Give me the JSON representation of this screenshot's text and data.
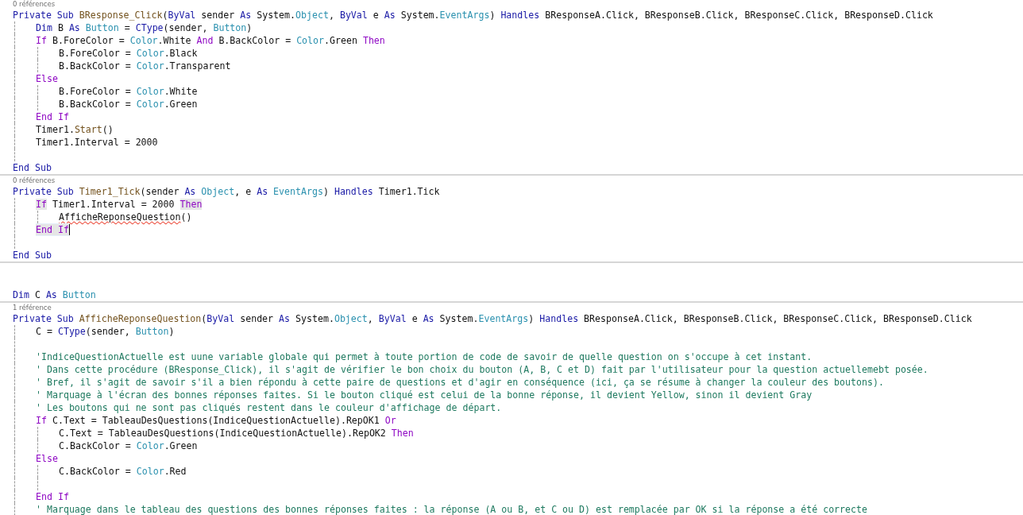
{
  "lines": [
    {
      "kind": "lens",
      "text": "0 références"
    },
    {
      "kind": "code",
      "tokens": [
        {
          "kind": "keyword",
          "text": "Private Sub "
        },
        {
          "kind": "method",
          "text": "BResponse_Click"
        },
        {
          "kind": "plain",
          "text": "("
        },
        {
          "kind": "keyword",
          "text": "ByVal "
        },
        {
          "kind": "plain",
          "text": "sender "
        },
        {
          "kind": "keyword",
          "text": "As "
        },
        {
          "kind": "plain",
          "text": "System."
        },
        {
          "kind": "type",
          "text": "Object"
        },
        {
          "kind": "plain",
          "text": ", "
        },
        {
          "kind": "keyword",
          "text": "ByVal "
        },
        {
          "kind": "plain",
          "text": "e "
        },
        {
          "kind": "keyword",
          "text": "As "
        },
        {
          "kind": "plain",
          "text": "System."
        },
        {
          "kind": "type",
          "text": "EventArgs"
        },
        {
          "kind": "plain",
          "text": ") "
        },
        {
          "kind": "keyword",
          "text": "Handles "
        },
        {
          "kind": "plain",
          "text": "BResponseA.Click, BResponseB.Click, BResponseC.Click, BResponseD.Click"
        }
      ],
      "children": [
        {
          "kind": "code",
          "tokens": [
            {
              "kind": "keyword",
              "text": "Dim "
            },
            {
              "kind": "plain",
              "text": "B "
            },
            {
              "kind": "keyword",
              "text": "As "
            },
            {
              "kind": "type",
              "text": "Button"
            },
            {
              "kind": "plain",
              "text": " = "
            },
            {
              "kind": "keyword",
              "text": "CType"
            },
            {
              "kind": "plain",
              "text": "(sender, "
            },
            {
              "kind": "type",
              "text": "Button"
            },
            {
              "kind": "plain",
              "text": ")"
            }
          ]
        },
        {
          "kind": "code",
          "tokens": [
            {
              "kind": "control",
              "text": "If "
            },
            {
              "kind": "plain",
              "text": "B.ForeColor = "
            },
            {
              "kind": "type",
              "text": "Color"
            },
            {
              "kind": "plain",
              "text": ".White "
            },
            {
              "kind": "control",
              "text": "And "
            },
            {
              "kind": "plain",
              "text": "B.BackColor = "
            },
            {
              "kind": "type",
              "text": "Color"
            },
            {
              "kind": "plain",
              "text": ".Green "
            },
            {
              "kind": "control",
              "text": "Then"
            }
          ],
          "children": [
            {
              "kind": "code",
              "tokens": [
                {
                  "kind": "plain",
                  "text": "B.ForeColor = "
                },
                {
                  "kind": "type",
                  "text": "Color"
                },
                {
                  "kind": "plain",
                  "text": ".Black"
                }
              ]
            },
            {
              "kind": "code",
              "tokens": [
                {
                  "kind": "plain",
                  "text": "B.BackColor = "
                },
                {
                  "kind": "type",
                  "text": "Color"
                },
                {
                  "kind": "plain",
                  "text": ".Transparent"
                }
              ]
            }
          ]
        },
        {
          "kind": "code",
          "tokens": [
            {
              "kind": "control",
              "text": "Else"
            }
          ],
          "children": [
            {
              "kind": "code",
              "tokens": [
                {
                  "kind": "plain",
                  "text": "B.ForeColor = "
                },
                {
                  "kind": "type",
                  "text": "Color"
                },
                {
                  "kind": "plain",
                  "text": ".White"
                }
              ]
            },
            {
              "kind": "code",
              "tokens": [
                {
                  "kind": "plain",
                  "text": "B.BackColor = "
                },
                {
                  "kind": "type",
                  "text": "Color"
                },
                {
                  "kind": "plain",
                  "text": ".Green"
                }
              ]
            }
          ]
        },
        {
          "kind": "code",
          "tokens": [
            {
              "kind": "control",
              "text": "End If"
            }
          ]
        },
        {
          "kind": "code",
          "tokens": [
            {
              "kind": "plain",
              "text": "Timer1."
            },
            {
              "kind": "method",
              "text": "Start"
            },
            {
              "kind": "plain",
              "text": "()"
            }
          ]
        },
        {
          "kind": "code",
          "tokens": [
            {
              "kind": "plain",
              "text": "Timer1.Interval = 2000"
            }
          ]
        },
        {
          "kind": "blank"
        }
      ]
    },
    {
      "kind": "code",
      "tokens": [
        {
          "kind": "keyword",
          "text": "End Sub"
        }
      ]
    },
    {
      "kind": "lens",
      "divider": true,
      "text": "0 références"
    },
    {
      "kind": "code",
      "tokens": [
        {
          "kind": "keyword",
          "text": "Private Sub "
        },
        {
          "kind": "method",
          "text": "Timer1_Tick"
        },
        {
          "kind": "plain",
          "text": "(sender "
        },
        {
          "kind": "keyword",
          "text": "As "
        },
        {
          "kind": "type",
          "text": "Object"
        },
        {
          "kind": "plain",
          "text": ", e "
        },
        {
          "kind": "keyword",
          "text": "As "
        },
        {
          "kind": "type",
          "text": "EventArgs"
        },
        {
          "kind": "plain",
          "text": ") "
        },
        {
          "kind": "keyword",
          "text": "Handles "
        },
        {
          "kind": "plain",
          "text": "Timer1.Tick"
        }
      ],
      "children": [
        {
          "kind": "code",
          "tokens": [
            {
              "kind": "control",
              "text": "If",
              "highlight": true
            },
            {
              "kind": "plain",
              "text": " Timer1.Interval = 2000 "
            },
            {
              "kind": "control",
              "text": "Then",
              "highlight": true
            }
          ],
          "children": [
            {
              "kind": "code",
              "tokens": [
                {
                  "kind": "plain",
                  "text": "AfficheReponseQuestion",
                  "squiggle": true
                },
                {
                  "kind": "plain",
                  "text": "()"
                }
              ]
            }
          ]
        },
        {
          "kind": "code",
          "current": true,
          "cursor": true,
          "tokens": [
            {
              "kind": "control",
              "text": "End If",
              "highlight": true
            }
          ]
        },
        {
          "kind": "blank"
        }
      ]
    },
    {
      "kind": "code",
      "tokens": [
        {
          "kind": "keyword",
          "text": "End Sub"
        }
      ]
    },
    {
      "kind": "blank",
      "divider": true
    },
    {
      "kind": "blank"
    },
    {
      "kind": "code",
      "tokens": [
        {
          "kind": "keyword",
          "text": "Dim "
        },
        {
          "kind": "plain",
          "text": "C "
        },
        {
          "kind": "keyword",
          "text": "As "
        },
        {
          "kind": "type",
          "text": "Button"
        }
      ]
    },
    {
      "kind": "lens",
      "divider": true,
      "text": "1 référence"
    },
    {
      "kind": "code",
      "tokens": [
        {
          "kind": "keyword",
          "text": "Private Sub "
        },
        {
          "kind": "method",
          "text": "AfficheReponseQuestion"
        },
        {
          "kind": "plain",
          "text": "("
        },
        {
          "kind": "keyword",
          "text": "ByVal "
        },
        {
          "kind": "plain",
          "text": "sender "
        },
        {
          "kind": "keyword",
          "text": "As "
        },
        {
          "kind": "plain",
          "text": "System."
        },
        {
          "kind": "type",
          "text": "Object"
        },
        {
          "kind": "plain",
          "text": ", "
        },
        {
          "kind": "keyword",
          "text": "ByVal "
        },
        {
          "kind": "plain",
          "text": "e "
        },
        {
          "kind": "keyword",
          "text": "As "
        },
        {
          "kind": "plain",
          "text": "System."
        },
        {
          "kind": "type",
          "text": "EventArgs"
        },
        {
          "kind": "plain",
          "text": ") "
        },
        {
          "kind": "keyword",
          "text": "Handles "
        },
        {
          "kind": "plain",
          "text": "BResponseA.Click, BResponseB.Click, BResponseC.Click, BResponseD.Click"
        }
      ],
      "children": [
        {
          "kind": "code",
          "tokens": [
            {
              "kind": "plain",
              "text": "C = "
            },
            {
              "kind": "keyword",
              "text": "CType"
            },
            {
              "kind": "plain",
              "text": "(sender, "
            },
            {
              "kind": "type",
              "text": "Button"
            },
            {
              "kind": "plain",
              "text": ")"
            }
          ]
        },
        {
          "kind": "blank"
        },
        {
          "kind": "code",
          "tokens": [
            {
              "kind": "comment",
              "text": "'IndiceQuestionActuelle est uune variable globale qui permet à toute portion de code de savoir de quelle question on s'occupe à cet instant."
            }
          ]
        },
        {
          "kind": "code",
          "tokens": [
            {
              "kind": "comment",
              "text": "' Dans cette procédure (BResponse_Click), il s'agit de vérifier le bon choix du bouton (A, B, C et D) fait par l'utilisateur pour la question actuellemebt posée."
            }
          ]
        },
        {
          "kind": "code",
          "tokens": [
            {
              "kind": "comment",
              "text": "' Bref, il s'agit de savoir s'il a bien répondu à cette paire de questions et d'agir en conséquence (ici, ça se résume à changer la couleur des boutons)."
            }
          ]
        },
        {
          "kind": "code",
          "tokens": [
            {
              "kind": "comment",
              "text": "' Marquage à l'écran des bonnes réponses faites. Si le bouton cliqué est celui de la bonne réponse, il devient Yellow, sinon il devient Gray"
            }
          ]
        },
        {
          "kind": "code",
          "tokens": [
            {
              "kind": "comment",
              "text": "' Les boutons qui ne sont pas cliqués restent dans le couleur d'affichage de départ."
            }
          ]
        },
        {
          "kind": "code",
          "tokens": [
            {
              "kind": "control",
              "text": "If "
            },
            {
              "kind": "plain",
              "text": "C.Text = TableauDesQuestions(IndiceQuestionActuelle).RepOK1 "
            },
            {
              "kind": "control",
              "text": "Or"
            }
          ],
          "children": [
            {
              "kind": "code",
              "tokens": [
                {
                  "kind": "plain",
                  "text": "C.Text = TableauDesQuestions(IndiceQuestionActuelle).RepOK2 "
                },
                {
                  "kind": "control",
                  "text": "Then"
                }
              ]
            },
            {
              "kind": "code",
              "tokens": [
                {
                  "kind": "plain",
                  "text": "C.BackColor = "
                },
                {
                  "kind": "type",
                  "text": "Color"
                },
                {
                  "kind": "plain",
                  "text": ".Green"
                }
              ]
            }
          ]
        },
        {
          "kind": "code",
          "tokens": [
            {
              "kind": "control",
              "text": "Else"
            }
          ],
          "children": [
            {
              "kind": "code",
              "tokens": [
                {
                  "kind": "plain",
                  "text": "C.BackColor = "
                },
                {
                  "kind": "type",
                  "text": "Color"
                },
                {
                  "kind": "plain",
                  "text": ".Red"
                }
              ]
            },
            {
              "kind": "blank"
            }
          ]
        },
        {
          "kind": "code",
          "tokens": [
            {
              "kind": "control",
              "text": "End If"
            }
          ]
        },
        {
          "kind": "code",
          "tokens": [
            {
              "kind": "comment",
              "text": "' Marquage dans le tableau des questions des bonnes réponses faites : la réponse (A ou B, et C ou D) est remplacée par OK si la réponse a été correcte"
            }
          ]
        }
      ]
    }
  ]
}
